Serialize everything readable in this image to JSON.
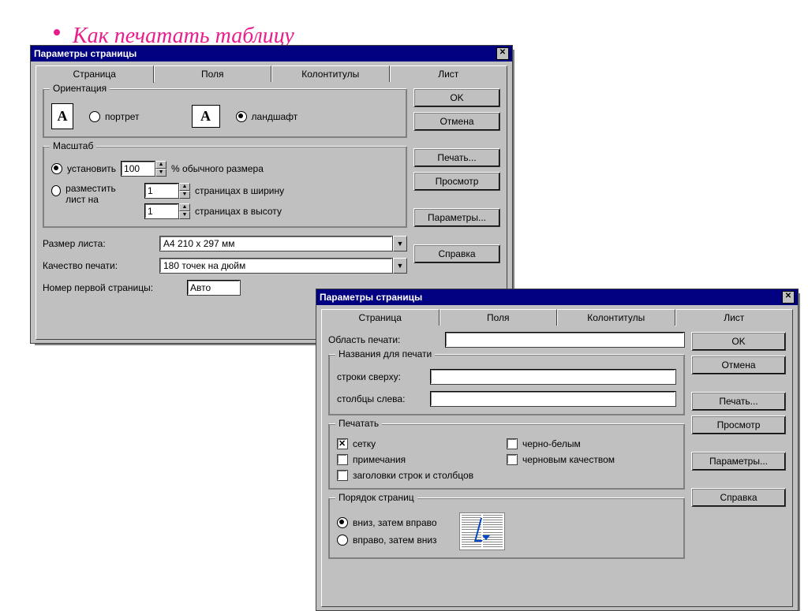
{
  "slide": {
    "title": "Как печатать таблицу"
  },
  "win1": {
    "title": "Параметры страницы",
    "tabs": [
      "Страница",
      "Поля",
      "Колонтитулы",
      "Лист"
    ],
    "active_tab": 0,
    "buttons": {
      "ok": "OK",
      "cancel": "Отмена",
      "print": "Печать...",
      "preview": "Просмотр",
      "params": "Параметры...",
      "help": "Справка"
    },
    "orientation": {
      "legend": "Ориентация",
      "portrait": "портрет",
      "landscape": "ландшафт",
      "selected": "landscape"
    },
    "scale": {
      "legend": "Масштаб",
      "set_label": "установить",
      "set_value": "100",
      "set_suffix": "% обычного размера",
      "fit_label": "разместить лист на",
      "pages_wide_value": "1",
      "pages_wide_suffix": "страницах в ширину",
      "pages_tall_value": "1",
      "pages_tall_suffix": "страницах в высоту",
      "selected": "set"
    },
    "paper_size_label": "Размер листа:",
    "paper_size_value": "A4 210 x 297 мм",
    "print_quality_label": "Качество печати:",
    "print_quality_value": "180 точек на дюйм",
    "first_page_label": "Номер первой страницы:",
    "first_page_value": "Авто"
  },
  "win2": {
    "title": "Параметры страницы",
    "tabs": [
      "Страница",
      "Поля",
      "Колонтитулы",
      "Лист"
    ],
    "active_tab": 3,
    "buttons": {
      "ok": "OK",
      "cancel": "Отмена",
      "print": "Печать...",
      "preview": "Просмотр",
      "params": "Параметры...",
      "help": "Справка"
    },
    "print_area_label": "Область печати:",
    "print_area_value": "",
    "titles": {
      "legend": "Названия для печати",
      "rows_label": "строки сверху:",
      "rows_value": "",
      "cols_label": "столбцы слева:",
      "cols_value": ""
    },
    "printopts": {
      "legend": "Печатать",
      "grid": "сетку",
      "grid_on": true,
      "bw": "черно-белым",
      "bw_on": false,
      "notes": "примечания",
      "notes_on": false,
      "draft": "черновым качеством",
      "draft_on": false,
      "headers": "заголовки строк и столбцов",
      "headers_on": false
    },
    "order": {
      "legend": "Порядок страниц",
      "down_then_over": "вниз, затем вправо",
      "over_then_down": "вправо, затем вниз",
      "selected": "down_then_over"
    }
  }
}
